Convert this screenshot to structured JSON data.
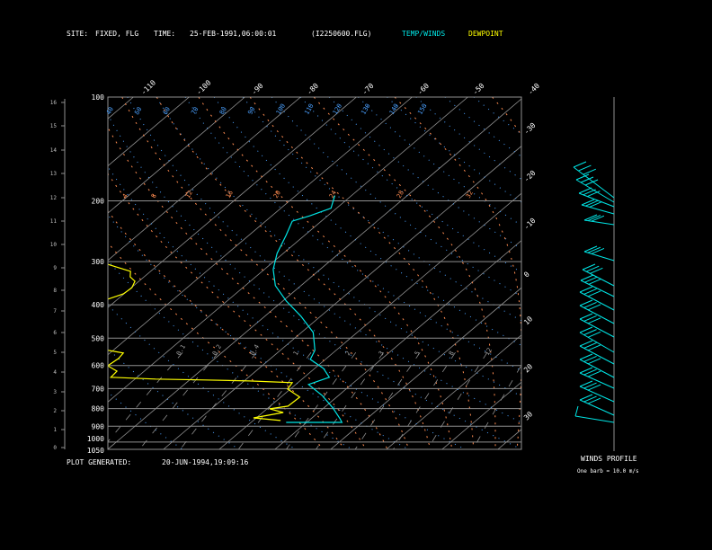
{
  "header": {
    "site_label": "SITE:",
    "site_value": "FIXED, FLG",
    "time_label": "TIME:",
    "time_value": "25-FEB-1991,06:00:01",
    "file": "(I2250600.FLG)",
    "legend_temp": "TEMP/WINDS",
    "legend_dewpoint": "DEWPOINT"
  },
  "footer": {
    "generated_label": "PLOT GENERATED:",
    "generated_value": "20-JUN-1994,19:09:16"
  },
  "winds_panel": {
    "title": "WINDS PROFILE",
    "note": "One barb = 10.0 m/s"
  },
  "colors": {
    "background": "#000000",
    "temperature": "#00e5e5",
    "dewpoint": "#ffff00",
    "dry_adiabat": "#4aa0ff",
    "moist_adiabat": "#ff8c50",
    "isotherm": "#909090",
    "mixing_ratio": "#909090",
    "isobar": "#909090",
    "text": "#ffffff"
  },
  "chart_data": {
    "type": "line",
    "diagram": "skew-T log-p",
    "y_scale": "log",
    "pressure_range_mb": [
      1050,
      100
    ],
    "pressure_ticks": [
      "100",
      "200",
      "300",
      "400",
      "500",
      "600",
      "700",
      "800",
      "900",
      "1000",
      "1050"
    ],
    "height_ticks_km": [
      "0",
      "1",
      "2",
      "3",
      "4",
      "5",
      "6",
      "7",
      "8",
      "9",
      "10",
      "11",
      "12",
      "13",
      "14",
      "15",
      "16"
    ],
    "isotherm_labels_top": [
      "-110",
      "-100",
      "-90",
      "-80",
      "-70",
      "-60",
      "-50",
      "-40"
    ],
    "isotherm_labels_right": [
      "-30",
      "-20",
      "-10",
      "0",
      "10",
      "20",
      "30"
    ],
    "dry_adiabat_labels": [
      "40",
      "50",
      "60",
      "70",
      "80",
      "90",
      "100",
      "110",
      "120",
      "130",
      "140",
      "150"
    ],
    "moist_adiabat_labels": [
      "4",
      "8",
      "12",
      "16",
      "20",
      "24",
      "28",
      "32"
    ],
    "mixing_ratio_labels": [
      "0.1",
      "0.2",
      "0.4",
      "1",
      "2",
      "3",
      "5",
      "8",
      "12"
    ],
    "series": [
      {
        "name": "TEMP/WINDS",
        "pressure_mb": [
          193,
          210,
          221,
          229,
          252,
          284,
          316,
          352,
          390,
          432,
          481,
          542,
          576,
          612,
          649,
          681,
          732,
          796,
          856,
          877,
          877
        ],
        "temperature_c": [
          -53.0,
          -51.0,
          -53.2,
          -55.2,
          -53.3,
          -51.1,
          -48.4,
          -44.6,
          -39.4,
          -33.5,
          -27.9,
          -23.8,
          -22.7,
          -18.4,
          -15.5,
          -17.7,
          -13.0,
          -8.4,
          -4.8,
          -3.7,
          -13.7
        ]
      },
      {
        "name": "DEWPOINT",
        "segments": [
          {
            "pressure_mb": [
              305,
              311,
              320,
              332,
              342,
              357,
              372,
              386
            ],
            "temperature_c": [
              -79.3,
              -77.0,
              -73.6,
              -72.5,
              -70.7,
              -69.9,
              -70.1,
              -71.9
            ]
          },
          {
            "pressure_mb": [
              542,
              552,
              573,
              601,
              623,
              649,
              657,
              661,
              665,
              673,
              702,
              741,
              787,
              801,
              821,
              851,
              866
            ],
            "temperature_c": [
              -60.9,
              -57.6,
              -57.3,
              -57.7,
              -54.9,
              -54.7,
              -46.3,
              -37.2,
              -29.1,
              -21.0,
              -20.5,
              -16.6,
              -16.8,
              -19.5,
              -16.3,
              -20.5,
              -15.1
            ]
          }
        ]
      }
    ]
  }
}
